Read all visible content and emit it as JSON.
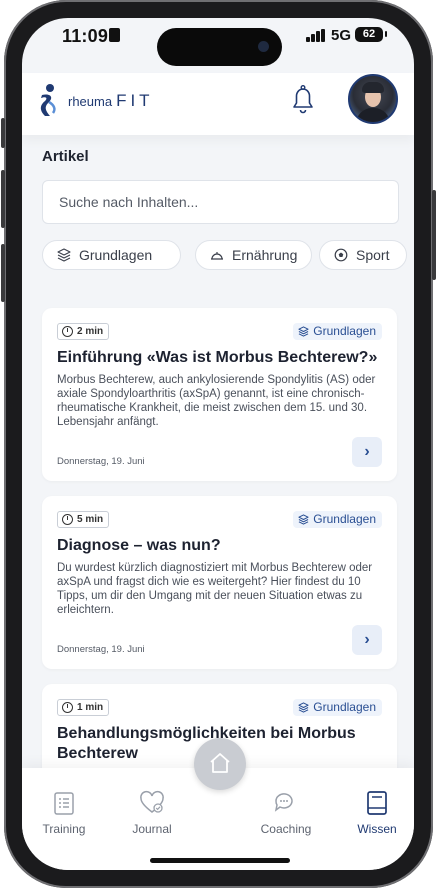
{
  "status_bar": {
    "time": "11:09",
    "network": "5G",
    "battery": "62"
  },
  "header": {
    "brand_prefix": "rheuma",
    "brand_suffix": "FIT"
  },
  "articles_section": {
    "title": "Artikel",
    "search_placeholder": "Suche nach Inhalten..."
  },
  "filters": [
    {
      "label": "Grundlagen",
      "icon": "layers-icon"
    },
    {
      "label": "Ernährung",
      "icon": "food-cover-icon"
    },
    {
      "label": "Sport",
      "icon": "ball-icon"
    }
  ],
  "articles": [
    {
      "duration": "2 min",
      "category": "Grundlagen",
      "title": "Einführung «Was ist Morbus Bechterew?»",
      "description": "Morbus Bechterew, auch ankylosierende Spondylitis (AS) oder axiale Spondyloarthritis (axSpA) genannt, ist eine chronisch-rheumatische Krankheit, die meist zwischen dem 15. und 30. Lebensjahr anfängt.",
      "date": "Donnerstag, 19. Juni"
    },
    {
      "duration": "5 min",
      "category": "Grundlagen",
      "title": "Diagnose – was nun?",
      "description": "Du wurdest kürzlich diagnostiziert mit Morbus Bechterew oder axSpA und fragst dich wie es weitergeht? Hier findest du 10 Tipps, um dir den Umgang mit der neuen Situation etwas zu erleichtern.",
      "date": "Donnerstag, 19. Juni"
    },
    {
      "duration": "1 min",
      "category": "Grundlagen",
      "title": "Behandlungsmöglichkeiten bei Morbus Bechterew",
      "description": "",
      "date": ""
    }
  ],
  "tabbar": [
    {
      "label": "Training",
      "icon": "clipboard-icon"
    },
    {
      "label": "Journal",
      "icon": "heart-check-icon"
    },
    {
      "label": "Coaching",
      "icon": "chat-bubbles-icon"
    },
    {
      "label": "Wissen",
      "icon": "book-icon"
    }
  ],
  "colors": {
    "brand": "#203a72",
    "accent_bg": "#e8eef8",
    "page_bg": "#f3f5f8"
  }
}
